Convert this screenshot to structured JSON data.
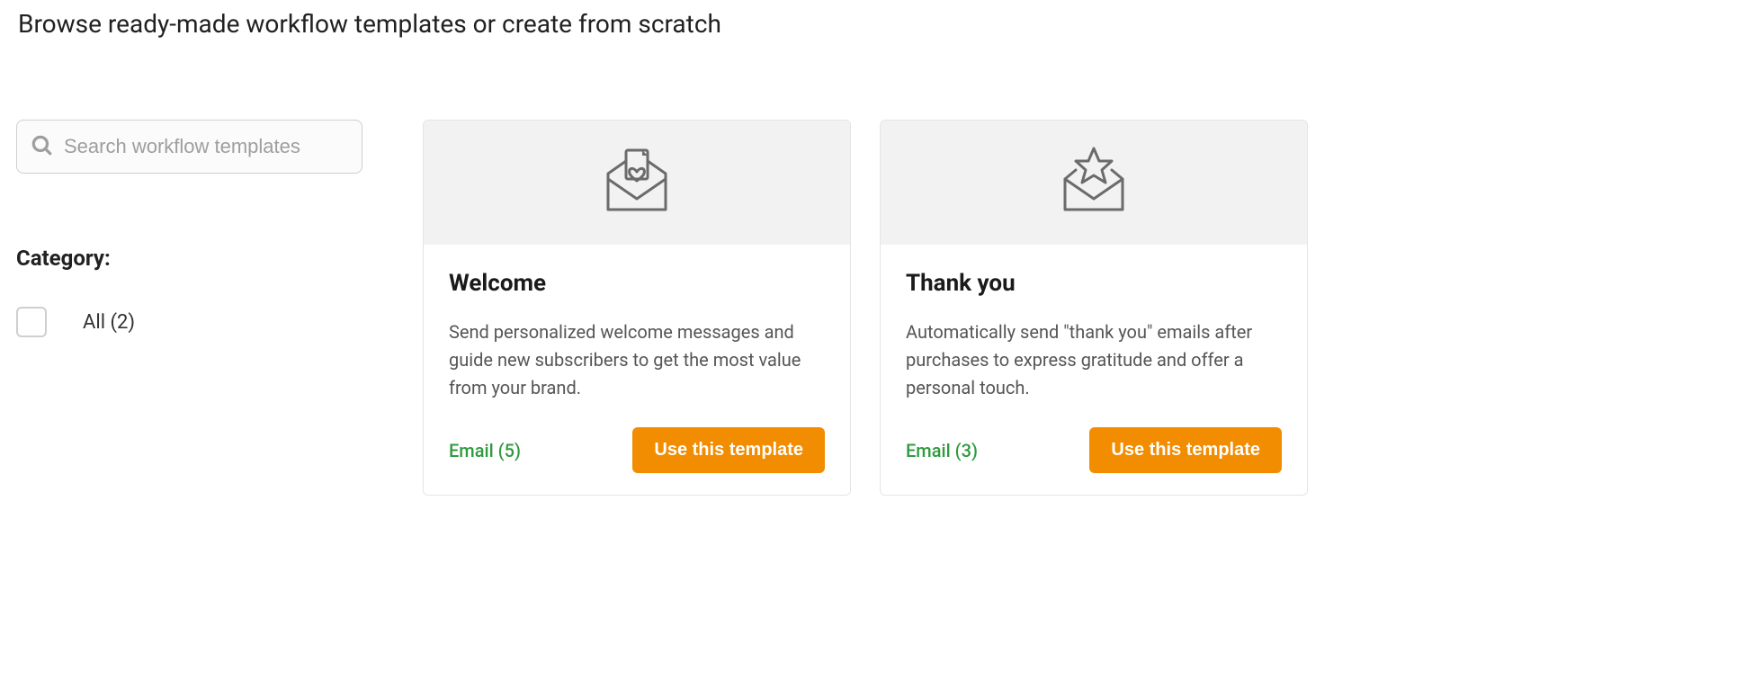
{
  "page_title": "Browse ready-made workflow templates or create from scratch",
  "search": {
    "placeholder": "Search workflow templates"
  },
  "category": {
    "heading": "Category:",
    "items": [
      {
        "label": "All (2)",
        "checked": false
      }
    ]
  },
  "cards": [
    {
      "icon": "envelope-heart",
      "title": "Welcome",
      "description": "Send personalized welcome messages and guide new subscribers to get the most value from your brand.",
      "email_count": "Email (5)",
      "button": "Use this template"
    },
    {
      "icon": "envelope-star",
      "title": "Thank you",
      "description": "Automatically send \"thank you\" emails after purchases to express gratitude and offer a personal touch.",
      "email_count": "Email (3)",
      "button": "Use this template"
    }
  ]
}
